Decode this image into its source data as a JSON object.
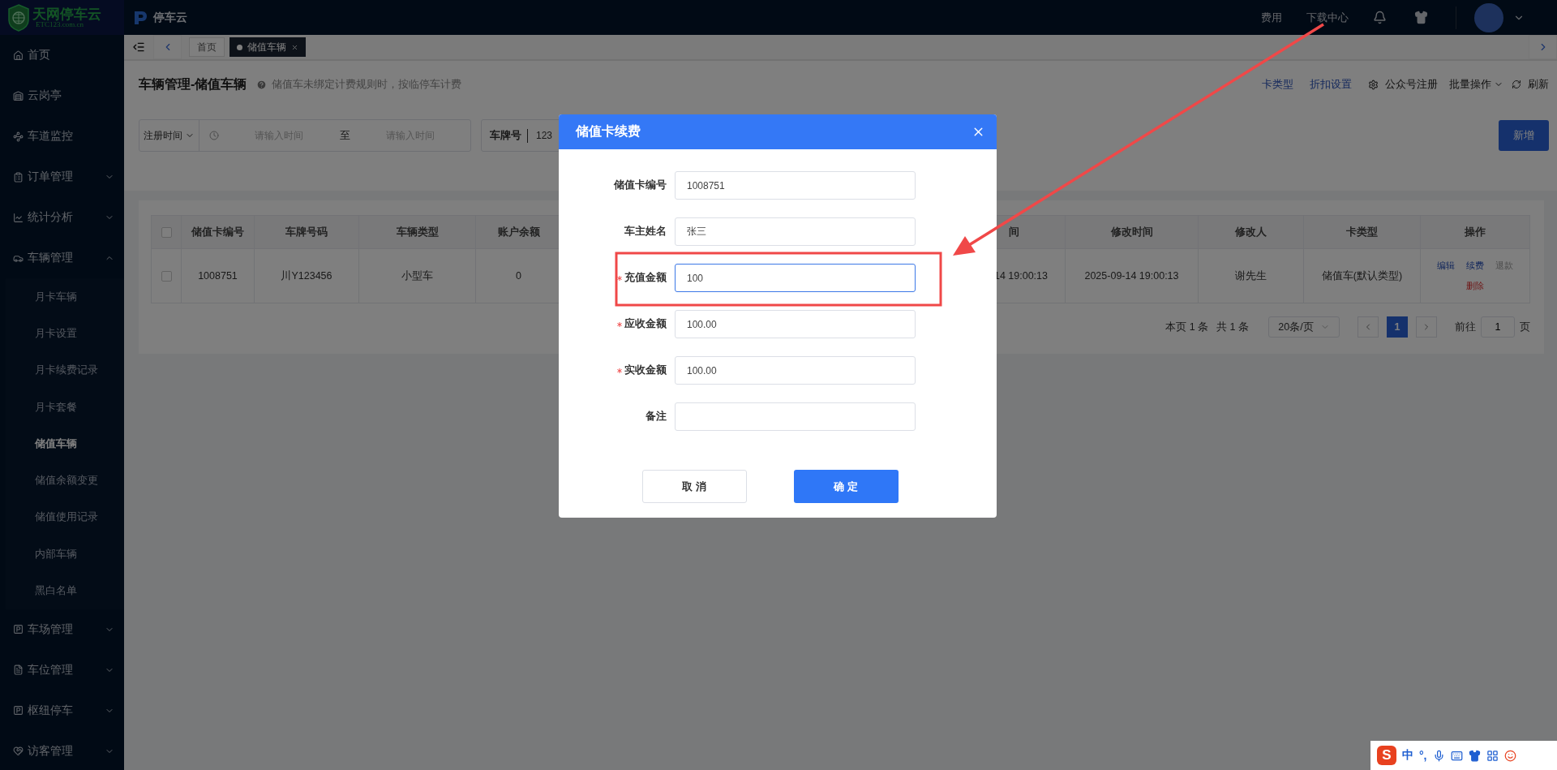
{
  "topbar": {
    "logo": {
      "title": "天网停车云",
      "subtitle": "ETC123.com.cn"
    },
    "app_name": "停车云",
    "links": [
      "费用",
      "下载中心"
    ]
  },
  "sidebar": {
    "items": [
      {
        "label": "首页",
        "kind": "link"
      },
      {
        "label": "云岗亭",
        "kind": "link"
      },
      {
        "label": "车道监控",
        "kind": "link"
      },
      {
        "label": "订单管理",
        "kind": "group",
        "expanded": false
      },
      {
        "label": "统计分析",
        "kind": "group",
        "expanded": false
      },
      {
        "label": "车辆管理",
        "kind": "group",
        "expanded": true,
        "children": [
          {
            "label": "月卡车辆",
            "selected": false
          },
          {
            "label": "月卡设置",
            "selected": false
          },
          {
            "label": "月卡续费记录",
            "selected": false
          },
          {
            "label": "月卡套餐",
            "selected": false
          },
          {
            "label": "储值车辆",
            "selected": true
          },
          {
            "label": "储值余额变更",
            "selected": false
          },
          {
            "label": "储值使用记录",
            "selected": false
          },
          {
            "label": "内部车辆",
            "selected": false
          },
          {
            "label": "黑白名单",
            "selected": false
          }
        ]
      },
      {
        "label": "车场管理",
        "kind": "group",
        "expanded": false
      },
      {
        "label": "车位管理",
        "kind": "group",
        "expanded": false
      },
      {
        "label": "枢纽停车",
        "kind": "group",
        "expanded": false
      },
      {
        "label": "访客管理",
        "kind": "group",
        "expanded": false
      }
    ]
  },
  "tabs": [
    {
      "label": "首页",
      "selected": false
    },
    {
      "label": "储值车辆",
      "selected": true
    }
  ],
  "page": {
    "title": "车辆管理-储值车辆",
    "hint": "储值车未绑定计费规则时，按临停车计费",
    "actions": [
      {
        "label": "卡类型",
        "kind": "link"
      },
      {
        "label": "折扣设置",
        "kind": "link"
      },
      {
        "label": "公众号注册",
        "kind": "gear"
      },
      {
        "label": "批量操作",
        "kind": "dropdown"
      },
      {
        "label": "刷新",
        "kind": "refresh"
      }
    ]
  },
  "filters": {
    "date_type": "注册时间",
    "start_placeholder": "请输入时间",
    "separator": "至",
    "end_placeholder": "请输入时间",
    "plate_label": "车牌号",
    "plate_value": "123"
  },
  "add_button": "新增",
  "table": {
    "header_checked": false,
    "columns": [
      {
        "kind": "text",
        "label": "储值卡编号"
      },
      {
        "kind": "text",
        "label": "车牌号码"
      },
      {
        "kind": "text",
        "label": "车辆类型"
      },
      {
        "kind": "text",
        "label": "账户余额"
      },
      {
        "kind": "clipped",
        "label": "间"
      },
      {
        "kind": "text",
        "label": "修改时间"
      },
      {
        "kind": "text",
        "label": "修改人"
      },
      {
        "kind": "text",
        "label": "卡类型"
      },
      {
        "kind": "text",
        "label": "操作"
      }
    ],
    "rows": [
      {
        "checked": false,
        "cells": [
          "1008751",
          "川Y123456",
          "小型车",
          "0",
          "14 19:00:13",
          "2025-09-14 19:00:13",
          "谢先生",
          "储值车(默认类型)"
        ],
        "actions": [
          {
            "label": "编辑",
            "kind": "primary"
          },
          {
            "label": "续费",
            "kind": "primary"
          },
          {
            "label": "退款",
            "kind": "muted"
          },
          {
            "label": "删除",
            "kind": "danger"
          }
        ]
      }
    ]
  },
  "pagination": {
    "page_info": "本页 1 条",
    "total": "共 1 条",
    "page_size": "20条/页",
    "pages": [
      {
        "label": "1",
        "selected": true
      }
    ],
    "goto_label": "前往",
    "goto_value": "1",
    "goto_suffix": "页"
  },
  "dialog": {
    "title": "储值卡续费",
    "fields": [
      {
        "label": "储值卡编号",
        "value": "1008751",
        "required": false,
        "focused": false
      },
      {
        "label": "车主姓名",
        "value": "张三",
        "required": false,
        "focused": false
      },
      {
        "label": "充值金额",
        "value": "100",
        "required": true,
        "focused": true,
        "highlighted": true
      },
      {
        "label": "应收金额",
        "value": "100.00",
        "required": true,
        "focused": false
      },
      {
        "label": "实收金额",
        "value": "100.00",
        "required": true,
        "focused": false
      },
      {
        "label": "备注",
        "required": false,
        "focused": false
      }
    ],
    "buttons": [
      {
        "label": "取 消",
        "kind": "secondary"
      },
      {
        "label": "确 定",
        "kind": "primary"
      }
    ]
  },
  "ime": {
    "logo": "S",
    "language": "中",
    "punctuation": "°,"
  }
}
